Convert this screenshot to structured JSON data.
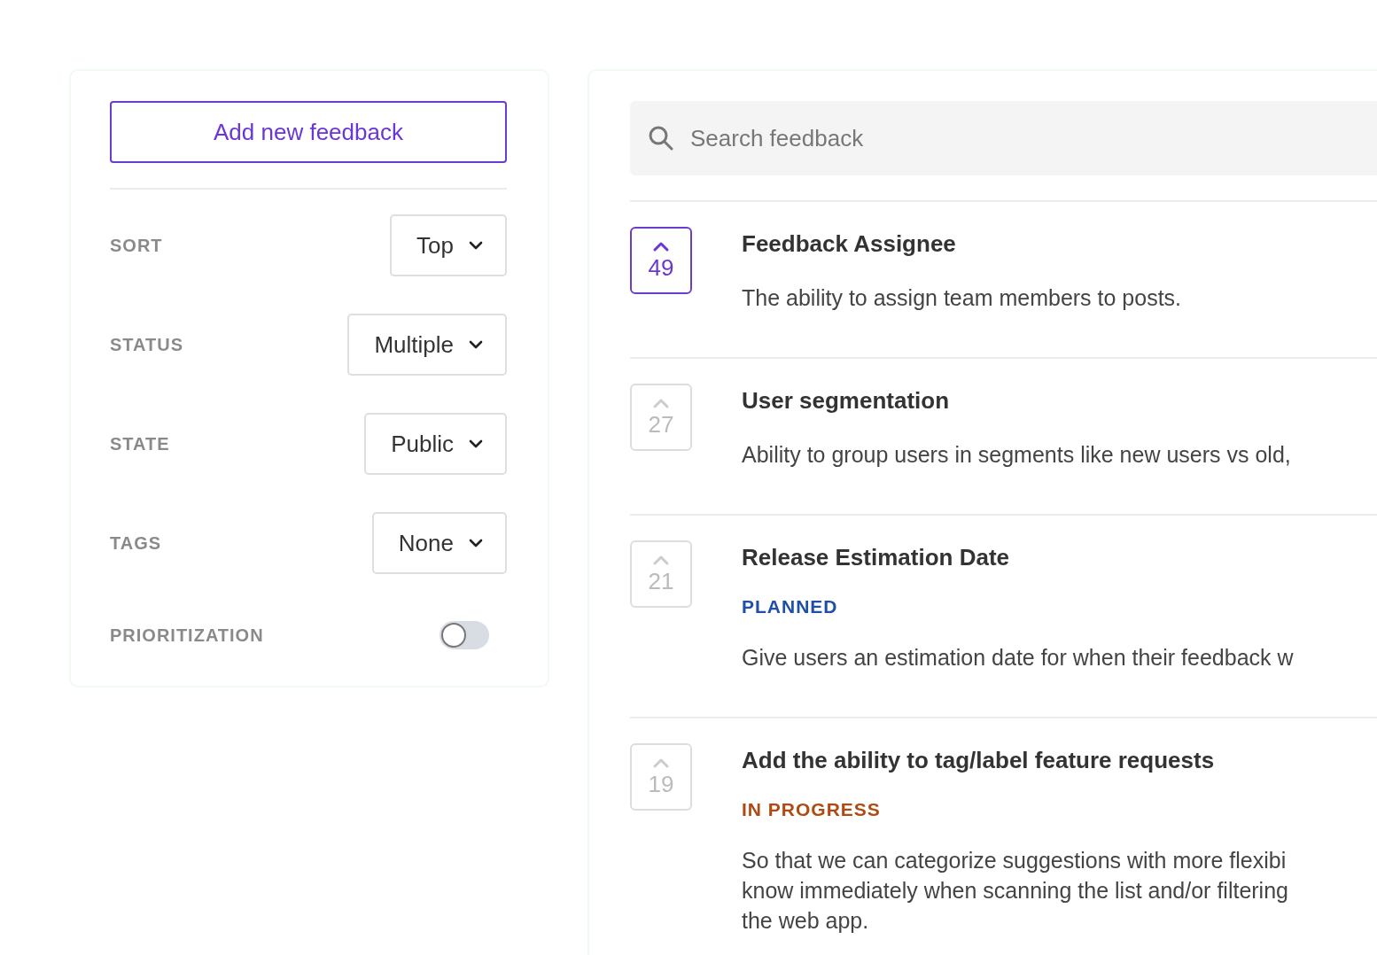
{
  "sidebar": {
    "add_button": "Add new feedback",
    "filters": [
      {
        "kind": "dropdown",
        "label": "SORT",
        "value": "Top"
      },
      {
        "kind": "dropdown",
        "label": "STATUS",
        "value": "Multiple"
      },
      {
        "kind": "dropdown",
        "label": "STATE",
        "value": "Public"
      },
      {
        "kind": "dropdown",
        "label": "TAGS",
        "value": "None"
      },
      {
        "kind": "toggle",
        "label": "PRIORITIZATION",
        "on": false
      }
    ]
  },
  "search": {
    "placeholder": "Search feedback"
  },
  "posts": [
    {
      "votes": "49",
      "selected": true,
      "title": "Feedback Assignee",
      "body": "The ability to assign team members to posts."
    },
    {
      "votes": "27",
      "selected": false,
      "title": "User segmentation",
      "body": "Ability to group users in segments like new users vs old,"
    },
    {
      "votes": "21",
      "selected": false,
      "title": "Release Estimation Date",
      "status": "PLANNED",
      "color": "#1f4fa6",
      "body": "Give users an estimation date for when their feedback w"
    },
    {
      "votes": "19",
      "selected": false,
      "title": "Add the ability to tag/label feature requests",
      "status": "IN PROGRESS",
      "color": "#b04a12",
      "body": "So that we can categorize suggestions with more flexibi\nknow immediately when scanning the list and/or filtering\nthe web app."
    }
  ]
}
